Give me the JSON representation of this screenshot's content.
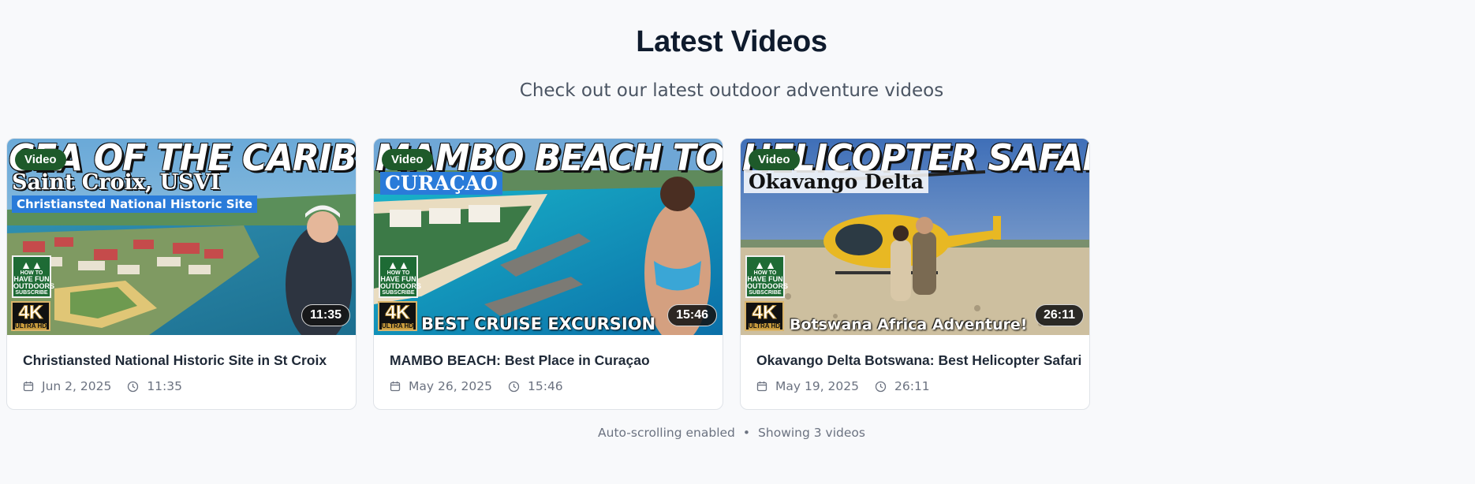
{
  "section": {
    "title": "Latest Videos",
    "subtitle": "Check out our latest outdoor adventure videos"
  },
  "videos": [
    {
      "badge": "Video",
      "thumb_banner": "CEA OF THE CARIBBEAN!",
      "thumb_place": "Saint Croix, USVI",
      "thumb_sub": "Christiansted National Historic Site",
      "thumb_caption": "",
      "duration_badge": "11:35",
      "title": "Christiansted National Historic Site in St Croix",
      "date": "Jun 2, 2025",
      "duration": "11:35"
    },
    {
      "badge": "Video",
      "thumb_banner": "MAMBO BEACH TOUR!",
      "thumb_place": "CURAÇAO",
      "thumb_sub": "",
      "thumb_caption": "BEST CRUISE EXCURSION",
      "duration_badge": "15:46",
      "title": "MAMBO BEACH: Best Place in Curaçao",
      "date": "May 26, 2025",
      "duration": "15:46"
    },
    {
      "badge": "Video",
      "thumb_banner": "HELICOPTER SAFARI!",
      "thumb_place": "Okavango Delta",
      "thumb_sub": "",
      "thumb_caption": "Botswana Africa Adventure!",
      "duration_badge": "26:11",
      "title": "Okavango Delta Botswana: Best Helicopter Safari",
      "date": "May 19, 2025",
      "duration": "26:11"
    }
  ],
  "channel_logo": {
    "line1": "HOW TO",
    "line2": "HAVE FUN",
    "line3": "OUTDOORS",
    "line4": "SUBSCRIBE"
  },
  "quality_badge": {
    "big": "4K",
    "small": "ULTRA HD"
  },
  "footer": {
    "status": "Auto-scrolling enabled",
    "separator": "•",
    "count": "Showing 3 videos"
  },
  "icons": {
    "date": "calendar-icon",
    "duration": "clock-icon",
    "logo": "mountain-icon"
  },
  "colors": {
    "badge_green": "#1e5a2a",
    "title_dark": "#0f1b2d",
    "muted_text": "#6b7280"
  }
}
